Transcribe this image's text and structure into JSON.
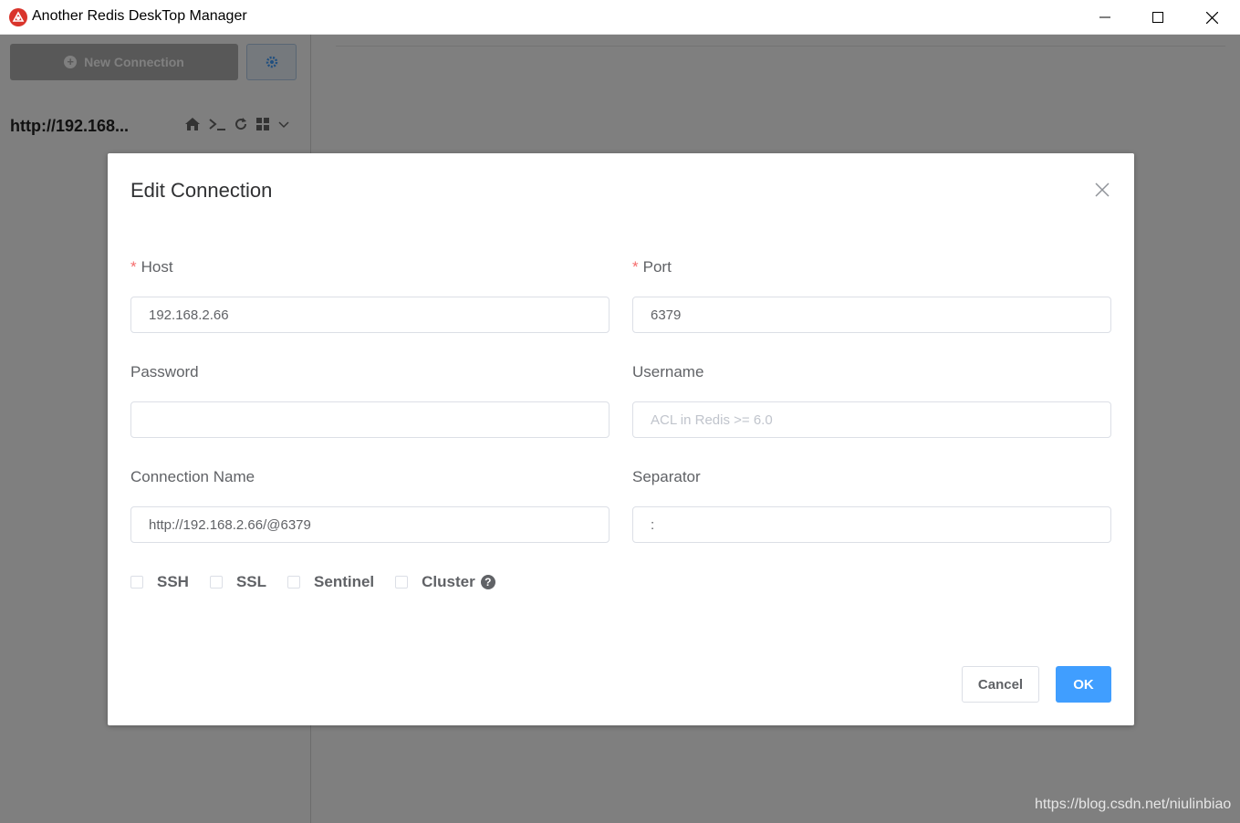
{
  "window": {
    "title": "Another Redis DeskTop Manager"
  },
  "sidebar": {
    "new_connection_label": "New Connection",
    "connection_name": "http://192.168..."
  },
  "dialog": {
    "title": "Edit Connection",
    "host": {
      "label": "Host",
      "value": "192.168.2.66",
      "required": true
    },
    "port": {
      "label": "Port",
      "value": "6379",
      "required": true
    },
    "password": {
      "label": "Password",
      "value": ""
    },
    "username": {
      "label": "Username",
      "placeholder": "ACL in Redis >= 6.0"
    },
    "connection_name": {
      "label": "Connection Name",
      "value": "http://192.168.2.66/@6379"
    },
    "separator": {
      "label": "Separator",
      "value": ":"
    },
    "required_mark": "*",
    "options": [
      {
        "label": "SSH",
        "checked": false
      },
      {
        "label": "SSL",
        "checked": false
      },
      {
        "label": "Sentinel",
        "checked": false
      },
      {
        "label": "Cluster",
        "checked": false
      }
    ],
    "help_glyph": "?",
    "cancel_label": "Cancel",
    "ok_label": "OK"
  },
  "watermark": "https://blog.csdn.net/niulinbiao",
  "colors": {
    "primary": "#409eff",
    "required": "#f56c6c",
    "overlay": "rgba(0,0,0,0.5)"
  }
}
